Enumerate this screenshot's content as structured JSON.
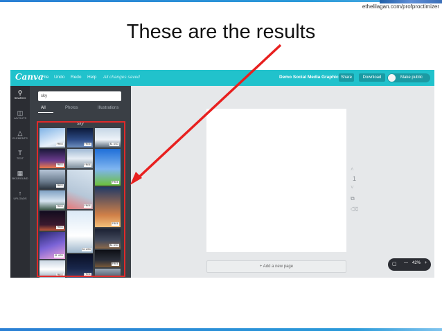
{
  "slide": {
    "credit": "ethelilagan.com/profproctimizer",
    "title": "These are the results"
  },
  "app": {
    "logo": "Canva",
    "menu": [
      "File",
      "Undo",
      "Redo",
      "Help"
    ],
    "status": "All changes saved",
    "doc_title": "Demo Social Media Graphic",
    "share_label": "Share",
    "download_label": "Download",
    "make_public_label": "Make public",
    "nav": [
      {
        "label": "SEARCH",
        "icon": "search-icon"
      },
      {
        "label": "LAYOUTS",
        "icon": "layouts-icon"
      },
      {
        "label": "ELEMENTS",
        "icon": "elements-icon"
      },
      {
        "label": "TEXT",
        "icon": "text-icon"
      },
      {
        "label": "BKGROUND",
        "icon": "background-icon"
      },
      {
        "label": "UPLOADS",
        "icon": "uploads-icon"
      }
    ],
    "search_value": "sky",
    "tabs": [
      "All",
      "Photos",
      "Illustrations"
    ],
    "results_label": "\"sky\"",
    "thumb_tags": [
      "FREE",
      "FREE",
      "FREE",
      "FREE",
      "FREE",
      "$1 USD",
      "FREE",
      "FREE",
      "FREE",
      "FREE",
      "$1 USD",
      "FREE",
      "$1 USD",
      "FREE",
      "FREE",
      "$1 USD",
      "FREE",
      "FREE"
    ],
    "page_number": "1",
    "add_page_label": "+ Add a new page",
    "zoom_minus": "—",
    "zoom_level": "42%",
    "zoom_plus": "+"
  },
  "colors": {
    "canva_teal": "#21c2cc",
    "sidebar_dark": "#2b2d33",
    "highlight_red": "#e02a2a"
  }
}
